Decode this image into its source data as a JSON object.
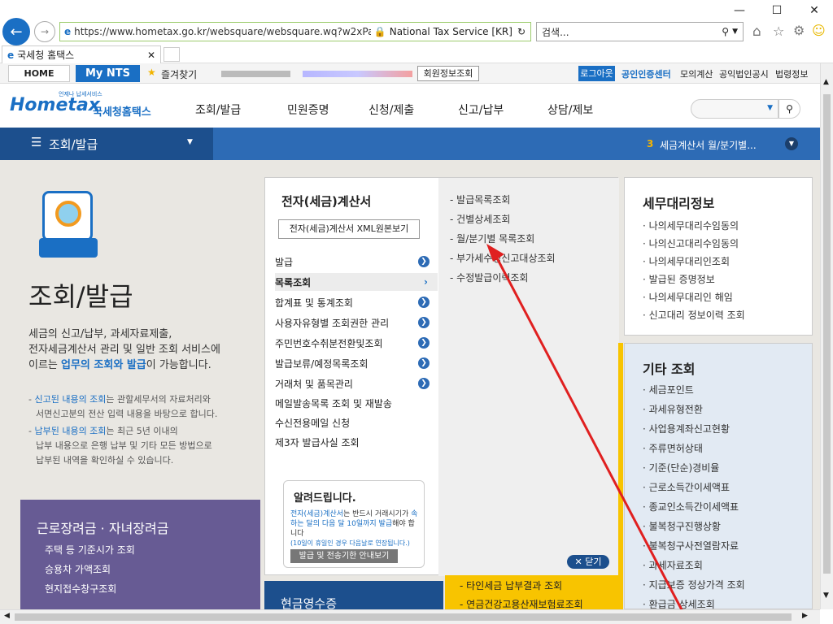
{
  "browser": {
    "url": "https://www.hometax.go.kr/websquare/websquare.wq?w2xPath=/",
    "cert": "National Tax Service [KR]",
    "search_placeholder": "검색...",
    "tab_title": "국세청 홈택스"
  },
  "favbar": {
    "home": "HOME",
    "mynts": "My NTS",
    "favorites": "즐겨찾기",
    "member_search": "회원정보조회",
    "logout": "로그아웃",
    "cert_center": "공인인증센터",
    "links": [
      "모의계산",
      "공익법인공시",
      "법령정보"
    ]
  },
  "site": {
    "logo_sub": "국세청홈택스",
    "logo_text": "Hometax",
    "logo_tag": "언제나 납세서비스",
    "gnb": [
      "조회/발급",
      "민원증명",
      "신청/제출",
      "신고/납부",
      "상담/제보"
    ]
  },
  "subbar": {
    "menu": "조회/발급",
    "rank": "3",
    "notice": "세금계산서 월/분기별..."
  },
  "intro": {
    "title": "조회/발급",
    "desc1": "세금의 신고/납부, 과세자료제출,",
    "desc2": "전자세금계산서 관리 및 일반 조회 서비스에",
    "desc3_pre": "이르는 ",
    "desc3_em": "업무의 조회와 발급",
    "desc3_post": "이 가능합니다.",
    "note1_em": "신고된 내용의 조회",
    "note1_rest": "는 관할세무서의 자료처리와",
    "note1_line2": "서면신고분의 전산 입력 내용을 바탕으로 합니다.",
    "note2_em": "납부된 내용의 조회",
    "note2_rest": "는 최근 5년 이내의",
    "note2_line2": "납부 내용으로 은행 납부 및 기타 모든 방법으로",
    "note2_line3": "납부된 내역을 확인하실 수 있습니다."
  },
  "eitc": {
    "title": "근로장려금 · 자녀장려금",
    "items": [
      "주택 등 기준시가 조회",
      "승용차 가액조회",
      "현지접수창구조회"
    ]
  },
  "mega": {
    "title": "전자(세금)계산서",
    "xml_btn": "전자(세금)계산서 XML원본보기",
    "items": [
      "발급",
      "목록조회",
      "합계표 및 통계조회",
      "사용자유형별 조회권한 관리",
      "주민번호수취분전환및조회",
      "발급보류/예정목록조회",
      "거래처 및 품목관리",
      "메일발송목록 조회 및 재발송",
      "수신전용메일 신청",
      "제3자 발급사실 조회"
    ],
    "sub_items": [
      "발급목록조회",
      "건별상세조회",
      "월/분기별 목록조회",
      "부가세수정신고대상조회",
      "수정발급이력조회"
    ],
    "notice_title": "알려드립니다.",
    "notice_em1": "전자(세금)계산서",
    "notice_t1": "는 반드시 거래시기가",
    "notice_em2": "속하는 달의 다음 달 10일까지 발급",
    "notice_t2": "해야 합니다",
    "notice_small": "(10일이 휴일인 경우 다음날로 연장됩니다.)",
    "notice_btn": "발급 및 전송기한 안내보기",
    "close": "닫기"
  },
  "agent": {
    "title": "세무대리정보",
    "items": [
      "나의세무대리수임동의",
      "나의신고대리수임동의",
      "나의세무대리인조회",
      "발급된 증명정보",
      "나의세무대리인 해임",
      "신고대리 정보이력 조회"
    ]
  },
  "etc": {
    "title": "기타 조회",
    "items": [
      "세금포인트",
      "과세유형전환",
      "사업용계좌신고현황",
      "주류면허상태",
      "기준(단순)경비율",
      "근로소득간이세액표",
      "종교인소득간이세액표",
      "불복청구진행상황",
      "불복청구사전열람자료",
      "과세자료조회",
      "지급보증 정상가격 조회",
      "환급금 상세조회"
    ]
  },
  "bottom": {
    "cash_title": "현금영수증",
    "yellow_items": [
      "타인세금 납부결과 조회",
      "연금건강고용산재보험료조회"
    ]
  },
  "colors": {
    "brand": "#2d6bb5",
    "dark": "#1c4f8d",
    "accent_red": "#e02020"
  }
}
